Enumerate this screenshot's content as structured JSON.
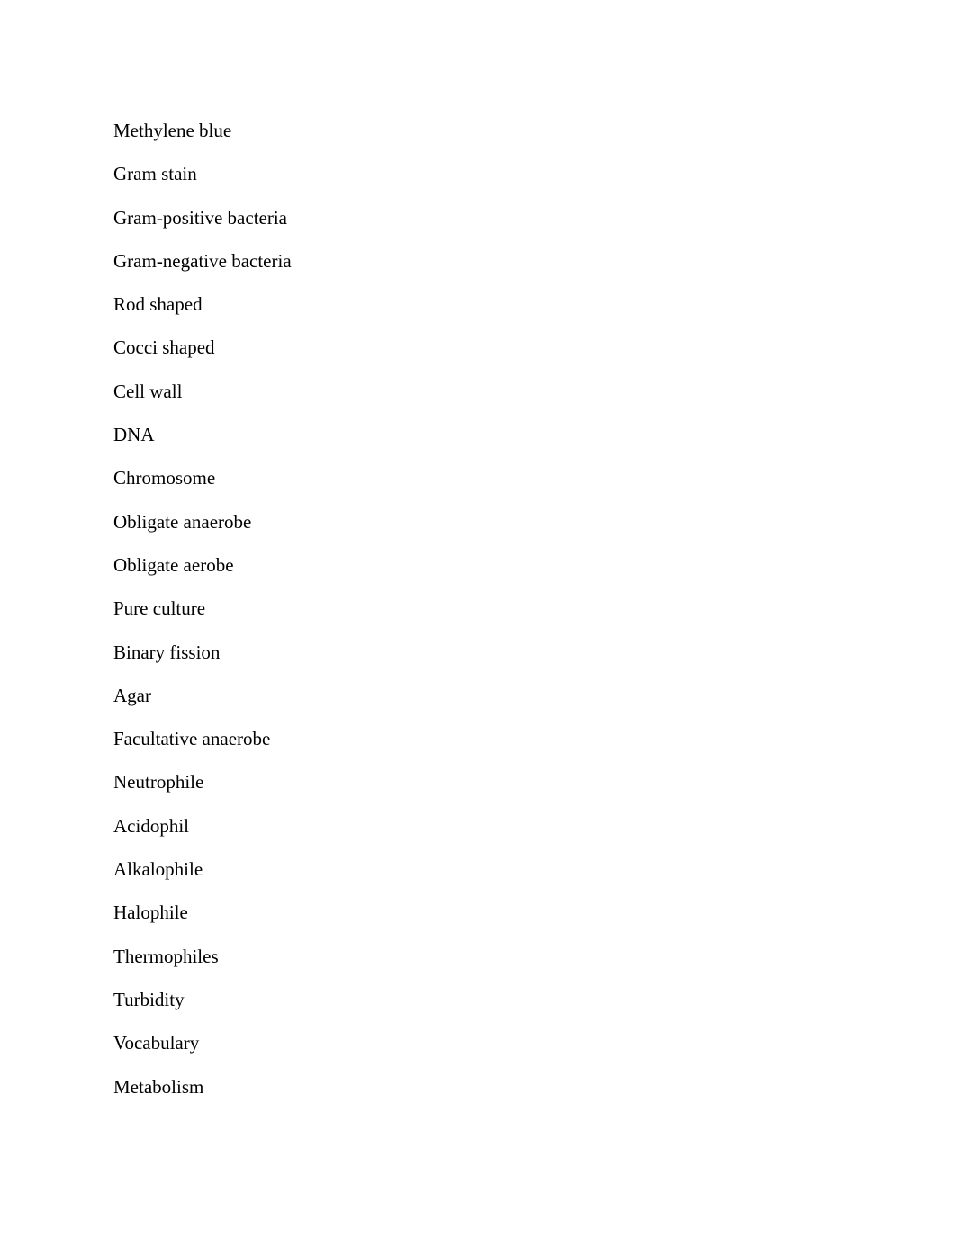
{
  "document": {
    "terms": [
      "Methylene blue",
      "Gram stain",
      "Gram-positive bacteria",
      "Gram-negative bacteria",
      "Rod shaped",
      "Cocci shaped",
      "Cell wall",
      "DNA",
      "Chromosome",
      "Obligate anaerobe",
      "Obligate aerobe",
      "Pure culture",
      "Binary fission",
      "Agar",
      "Facultative anaerobe",
      "Neutrophile",
      "Acidophil",
      "Alkalophile",
      "Halophile",
      "Thermophiles",
      "Turbidity",
      "Vocabulary",
      "Metabolism"
    ]
  }
}
